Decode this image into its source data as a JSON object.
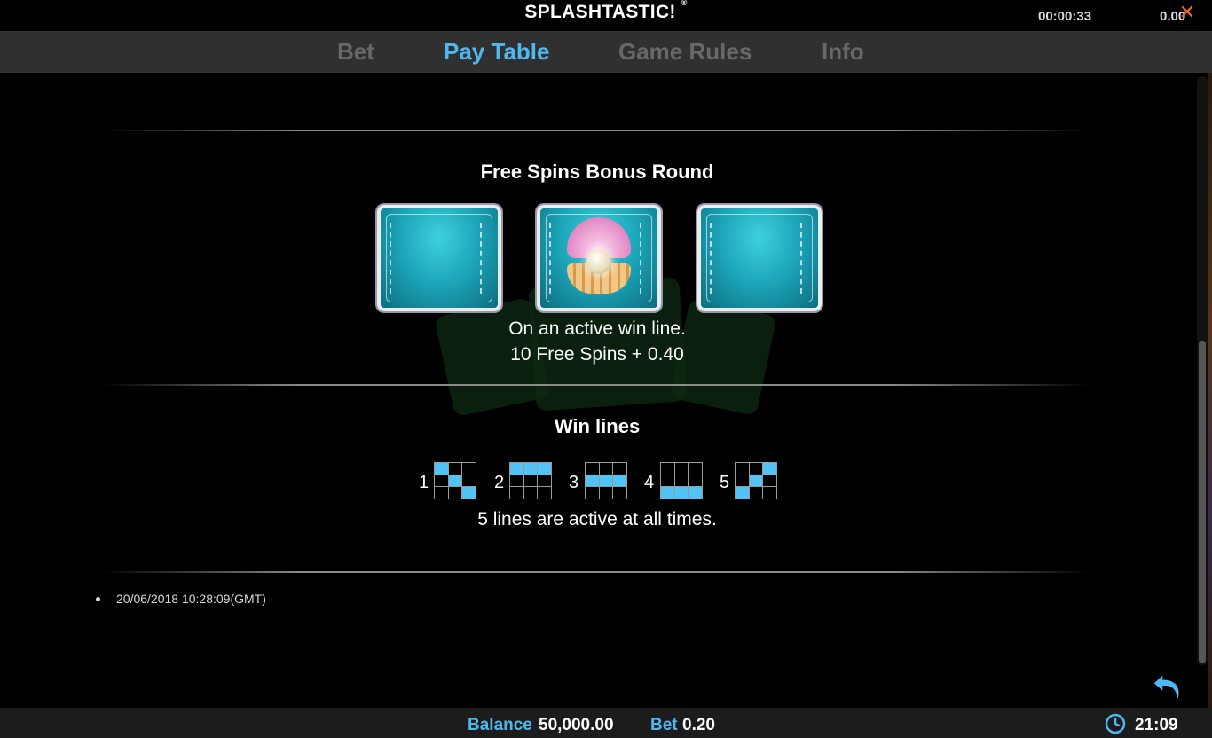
{
  "header": {
    "title": "SPLASHTASTIC!",
    "title_mark": "®",
    "timer": "00:00:33",
    "win_value": "0.00",
    "close_icon": "close-icon"
  },
  "tabs": [
    {
      "label": "Bet",
      "active": false
    },
    {
      "label": "Pay Table",
      "active": true
    },
    {
      "label": "Game Rules",
      "active": false
    },
    {
      "label": "Info",
      "active": false
    }
  ],
  "free_spins": {
    "heading": "Free Spins Bonus Round",
    "symbols": [
      "water-symbol",
      "pearl-shell-symbol",
      "water-symbol"
    ],
    "line1": "On an active win line.",
    "line2": "10 Free Spins + 0.40"
  },
  "win_lines": {
    "heading": "Win lines",
    "lines": [
      {
        "number": "1",
        "pattern": [
          [
            1,
            0,
            0
          ],
          [
            0,
            1,
            0
          ],
          [
            0,
            0,
            1
          ]
        ]
      },
      {
        "number": "2",
        "pattern": [
          [
            1,
            1,
            1
          ],
          [
            0,
            0,
            0
          ],
          [
            0,
            0,
            0
          ]
        ]
      },
      {
        "number": "3",
        "pattern": [
          [
            0,
            0,
            0
          ],
          [
            1,
            1,
            1
          ],
          [
            0,
            0,
            0
          ]
        ]
      },
      {
        "number": "4",
        "pattern": [
          [
            0,
            0,
            0
          ],
          [
            0,
            0,
            0
          ],
          [
            1,
            1,
            1
          ]
        ]
      },
      {
        "number": "5",
        "pattern": [
          [
            0,
            0,
            1
          ],
          [
            0,
            1,
            0
          ],
          [
            1,
            0,
            0
          ]
        ]
      }
    ],
    "note": "5 lines are active at all times."
  },
  "footer": {
    "timestamp": "20/06/2018 10:28:09(GMT)",
    "back_icon": "back-arrow-icon"
  },
  "status_bar": {
    "balance_label": "Balance",
    "balance_value": "50,000.00",
    "bet_label": "Bet",
    "bet_value": "0.20",
    "clock_icon": "clock-icon",
    "time": "21:09"
  },
  "colors": {
    "accent": "#4fb8ee",
    "tab_inactive": "#686868",
    "close": "#e46a2a",
    "line_cell_on": "#52c3f5"
  }
}
